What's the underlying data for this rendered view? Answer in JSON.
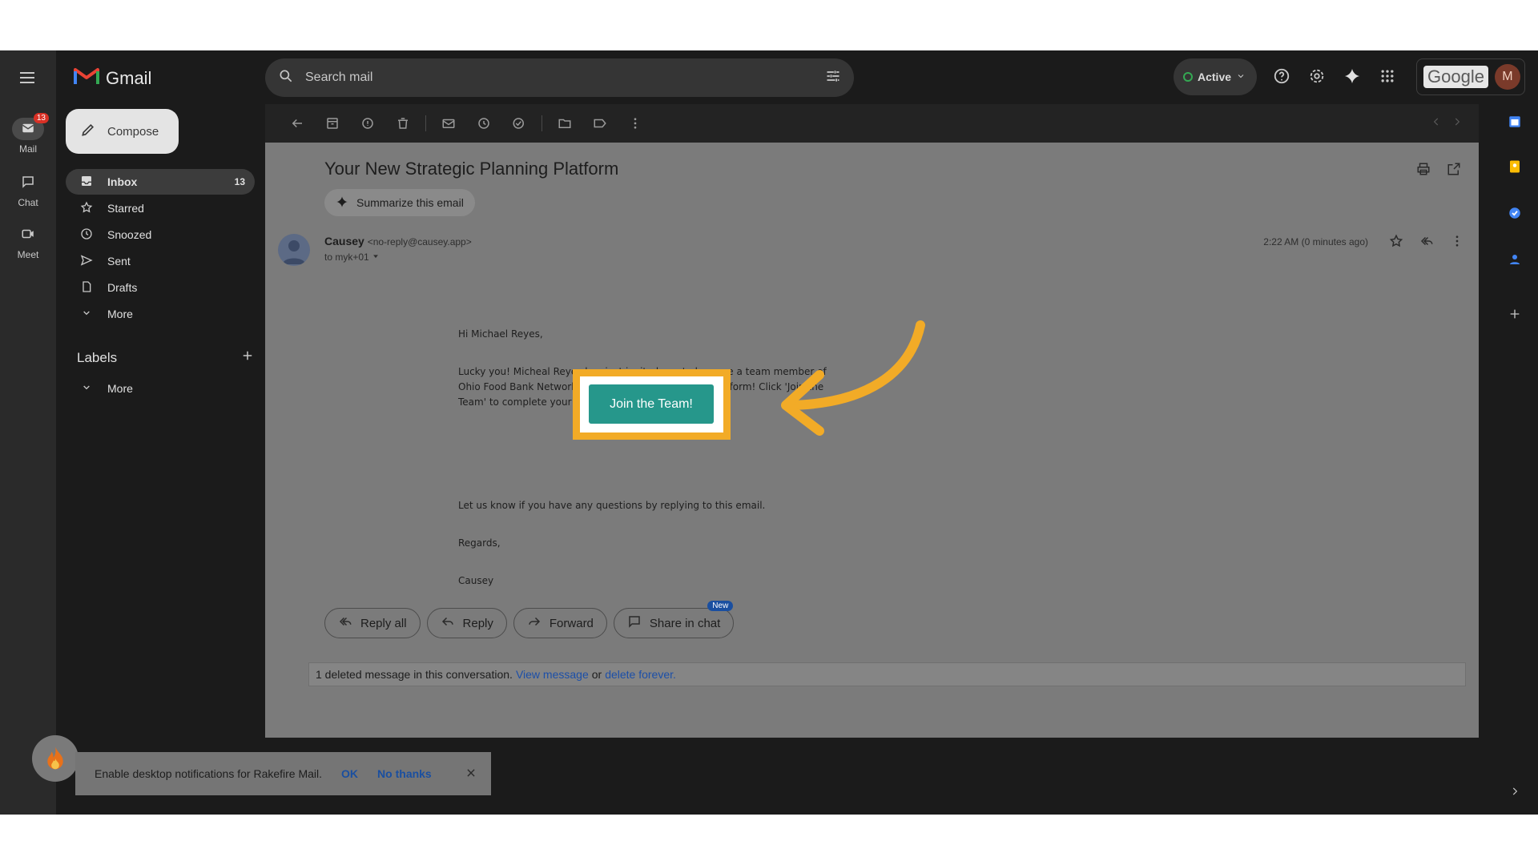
{
  "rail": {
    "items": [
      {
        "label": "Mail",
        "badge": "13"
      },
      {
        "label": "Chat"
      },
      {
        "label": "Meet"
      }
    ]
  },
  "app": {
    "name": "Gmail"
  },
  "compose": {
    "label": "Compose"
  },
  "nav": {
    "items": [
      {
        "label": "Inbox",
        "count": "13"
      },
      {
        "label": "Starred"
      },
      {
        "label": "Snoozed"
      },
      {
        "label": "Sent"
      },
      {
        "label": "Drafts"
      },
      {
        "label": "More"
      }
    ]
  },
  "labels": {
    "heading": "Labels",
    "more": "More"
  },
  "search": {
    "placeholder": "Search mail"
  },
  "status": {
    "label": "Active",
    "color": "#34a853"
  },
  "account": {
    "brand": "Google",
    "initial": "M"
  },
  "email": {
    "subject": "Your New Strategic Planning Platform",
    "summarize": "Summarize this email",
    "sender_name": "Causey",
    "sender_email": "<no-reply@causey.app>",
    "to": "to myk+01",
    "time": "2:22 AM (0 minutes ago)",
    "greeting": "Hi Michael Reyes,",
    "paragraph": "Lucky you! Micheal Reyes has just invited you to become a team member of Ohio Food Bank Network's online Strategic Planning platform! Click 'Join the Team' to complete your registration.",
    "cta": "Join the Team!",
    "followup": "Let us know if you have any questions by replying to this email.",
    "regards": "Regards,",
    "signature": "Causey"
  },
  "reply_buttons": {
    "reply_all": "Reply all",
    "reply": "Reply",
    "forward": "Forward",
    "share": "Share in chat",
    "new_badge": "New"
  },
  "deleted": {
    "text": "1 deleted message in this conversation.",
    "view": "View message",
    "or": "or",
    "delete": "delete forever."
  },
  "toast": {
    "text": "Enable desktop notifications for Rakefire Mail.",
    "ok": "OK",
    "no_thanks": "No thanks"
  },
  "colors": {
    "accent_cta": "#26978b",
    "highlight": "#f2ab27",
    "link": "#1c4fa8"
  }
}
